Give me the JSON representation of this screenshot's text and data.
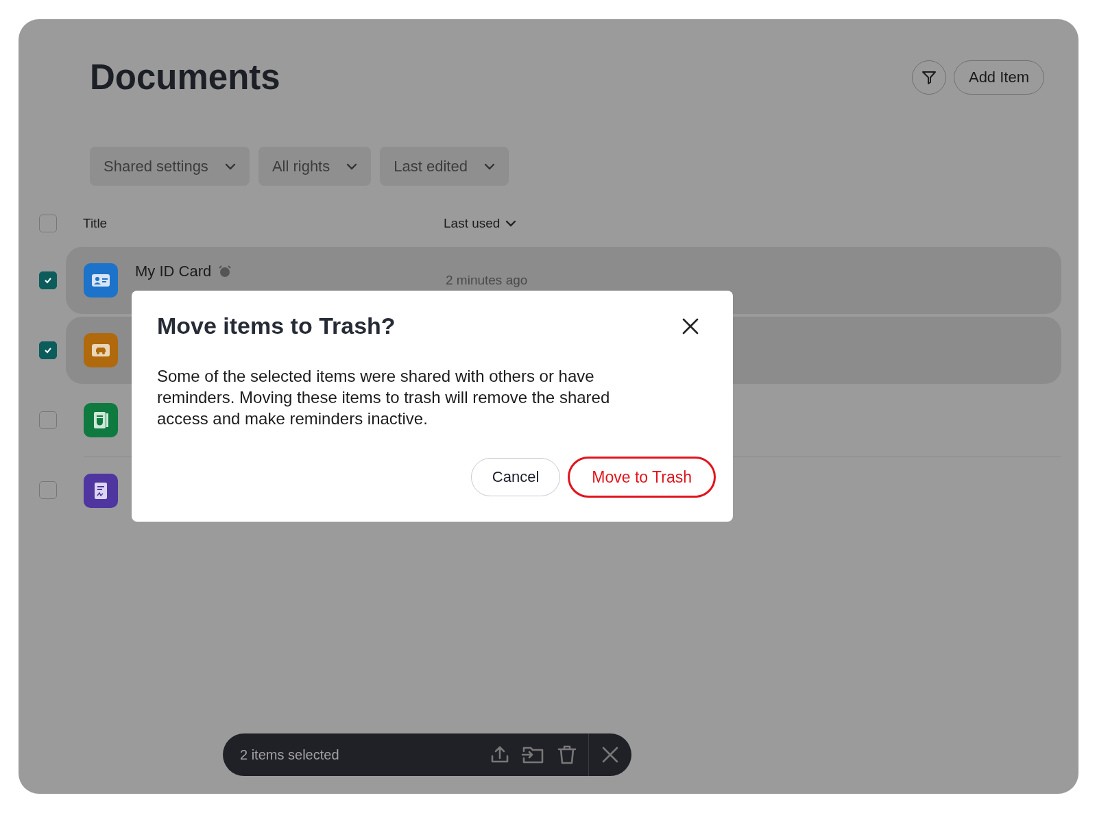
{
  "page": {
    "title": "Documents",
    "add_button": "Add Item"
  },
  "filters": [
    {
      "label": "Shared settings"
    },
    {
      "label": "All rights"
    },
    {
      "label": "Last edited"
    }
  ],
  "table": {
    "select_all_checked": false,
    "columns": [
      {
        "label": "Title"
      },
      {
        "label": "Last used"
      }
    ],
    "rows": [
      {
        "title": "My ID Card",
        "reminder": true,
        "last_used": "2 minutes ago",
        "checked": true,
        "kind": "id",
        "color": "#1d72c9"
      },
      {
        "checked": true,
        "kind": "vehicle",
        "color": "#b0690c"
      },
      {
        "checked": false,
        "kind": "passport",
        "color": "#0e7a3f"
      },
      {
        "checked": false,
        "kind": "receipt",
        "color": "#4f35a0"
      }
    ]
  },
  "dialog": {
    "title": "Move items to Trash?",
    "message": "Some of the selected items were shared with others or have reminders. Moving these items to trash will remove the shared access and make reminders inactive.",
    "cancel": "Cancel",
    "confirm": "Move to Trash"
  },
  "selection_bar": {
    "label": "2 items selected"
  }
}
